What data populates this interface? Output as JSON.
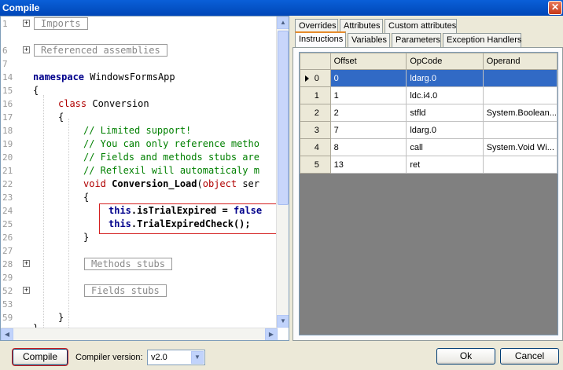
{
  "window": {
    "title": "Compile",
    "close_glyph": "✕"
  },
  "editor": {
    "line_numbers": [
      "1",
      "6",
      "7",
      "14",
      "15",
      "16",
      "17",
      "18",
      "19",
      "20",
      "21",
      "22",
      "23",
      "24",
      "25",
      "26",
      "27",
      "28",
      "29",
      "52",
      "53",
      "59",
      "65"
    ],
    "regions": {
      "imports": "Imports",
      "referenced_assemblies": "Referenced assemblies",
      "methods_stubs": "Methods stubs",
      "fields_stubs": "Fields stubs"
    },
    "code": {
      "namespace_kw": "namespace",
      "namespace_name": " WindowsFormsApp",
      "open_brace": "{",
      "close_brace": "}",
      "class_kw": "class",
      "class_name": " Conversion",
      "comment1": "// Limited support!",
      "comment2": "// You can only reference metho",
      "comment3": "// Fields and methods stubs are",
      "comment4": "// Reflexil will automaticaly m",
      "void_kw": "void",
      "method_name": " Conversion_Load",
      "param_open": "(",
      "object_kw": "object",
      "param_rest": " ser",
      "line25_this": "this",
      "line25_rest": ".isTrialExpired = ",
      "line25_false": "false",
      "line26_this": "this",
      "line26_rest": ".TrialExpiredCheck();"
    },
    "fold_glyph": "+"
  },
  "tabs_top": [
    "Overrides",
    "Attributes",
    "Custom attributes"
  ],
  "tabs_bottom": [
    "Instructions",
    "Variables",
    "Parameters",
    "Exception Handlers"
  ],
  "grid": {
    "columns": [
      "Offset",
      "OpCode",
      "Operand"
    ],
    "rows": [
      {
        "index": "0",
        "offset": "0",
        "opcode": "ldarg.0",
        "operand": ""
      },
      {
        "index": "1",
        "offset": "1",
        "opcode": "ldc.i4.0",
        "operand": ""
      },
      {
        "index": "2",
        "offset": "2",
        "opcode": "stfld",
        "operand": "System.Boolean..."
      },
      {
        "index": "3",
        "offset": "7",
        "opcode": "ldarg.0",
        "operand": ""
      },
      {
        "index": "4",
        "offset": "8",
        "opcode": "call",
        "operand": "System.Void Wi..."
      },
      {
        "index": "5",
        "offset": "13",
        "opcode": "ret",
        "operand": ""
      }
    ],
    "selected_row": 0
  },
  "footer": {
    "compile_label": "Compile",
    "compiler_version_label": "Compiler version:",
    "compiler_version_value": "v2.0",
    "ok_label": "Ok",
    "cancel_label": "Cancel"
  },
  "icons": {
    "scroll_up": "▲",
    "scroll_down": "▼",
    "scroll_left": "◀",
    "scroll_right": "▶",
    "dropdown": "▼"
  },
  "colors": {
    "titlebar": "#0553c7",
    "selection": "#316ac5",
    "highlight_box": "#d42020",
    "keyword": "#00008b",
    "comment": "#008000"
  }
}
